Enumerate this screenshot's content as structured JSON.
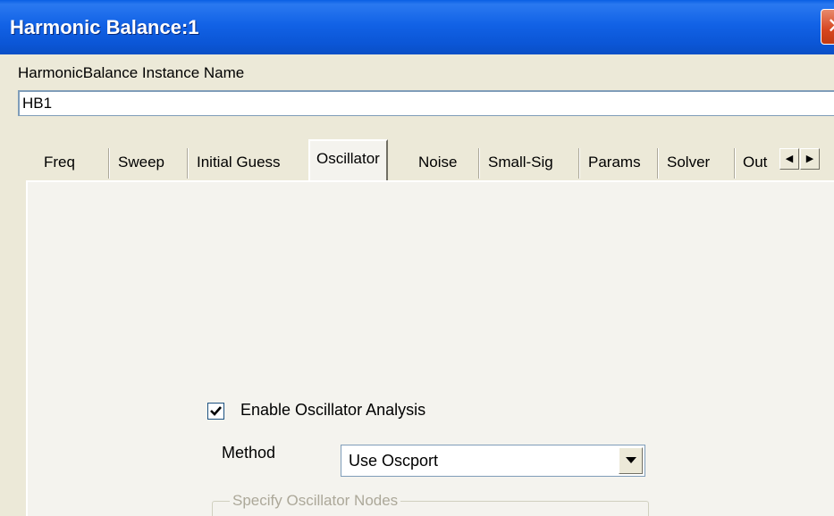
{
  "window": {
    "title": "Harmonic Balance:1",
    "close_icon": "close-icon",
    "accent_color": "#0b56d6"
  },
  "instance": {
    "label": "HarmonicBalance Instance Name",
    "value": "HB1"
  },
  "tabs": [
    {
      "label": "Freq",
      "active": false
    },
    {
      "label": "Sweep",
      "active": false
    },
    {
      "label": "Initial Guess",
      "active": false
    },
    {
      "label": "Oscillator",
      "active": true
    },
    {
      "label": "Noise",
      "active": false
    },
    {
      "label": "Small-Sig",
      "active": false
    },
    {
      "label": "Params",
      "active": false
    },
    {
      "label": "Solver",
      "active": false
    },
    {
      "label": "Out",
      "active": false
    }
  ],
  "tab_scroll": {
    "left_icon": "scroll-left-icon",
    "right_icon": "scroll-right-icon"
  },
  "oscillator": {
    "enable_label": "Enable Oscillator Analysis",
    "enable_checked": true,
    "method_label": "Method",
    "method_value": "Use Oscport",
    "nodes_group_label": "Specify Oscillator Nodes"
  }
}
